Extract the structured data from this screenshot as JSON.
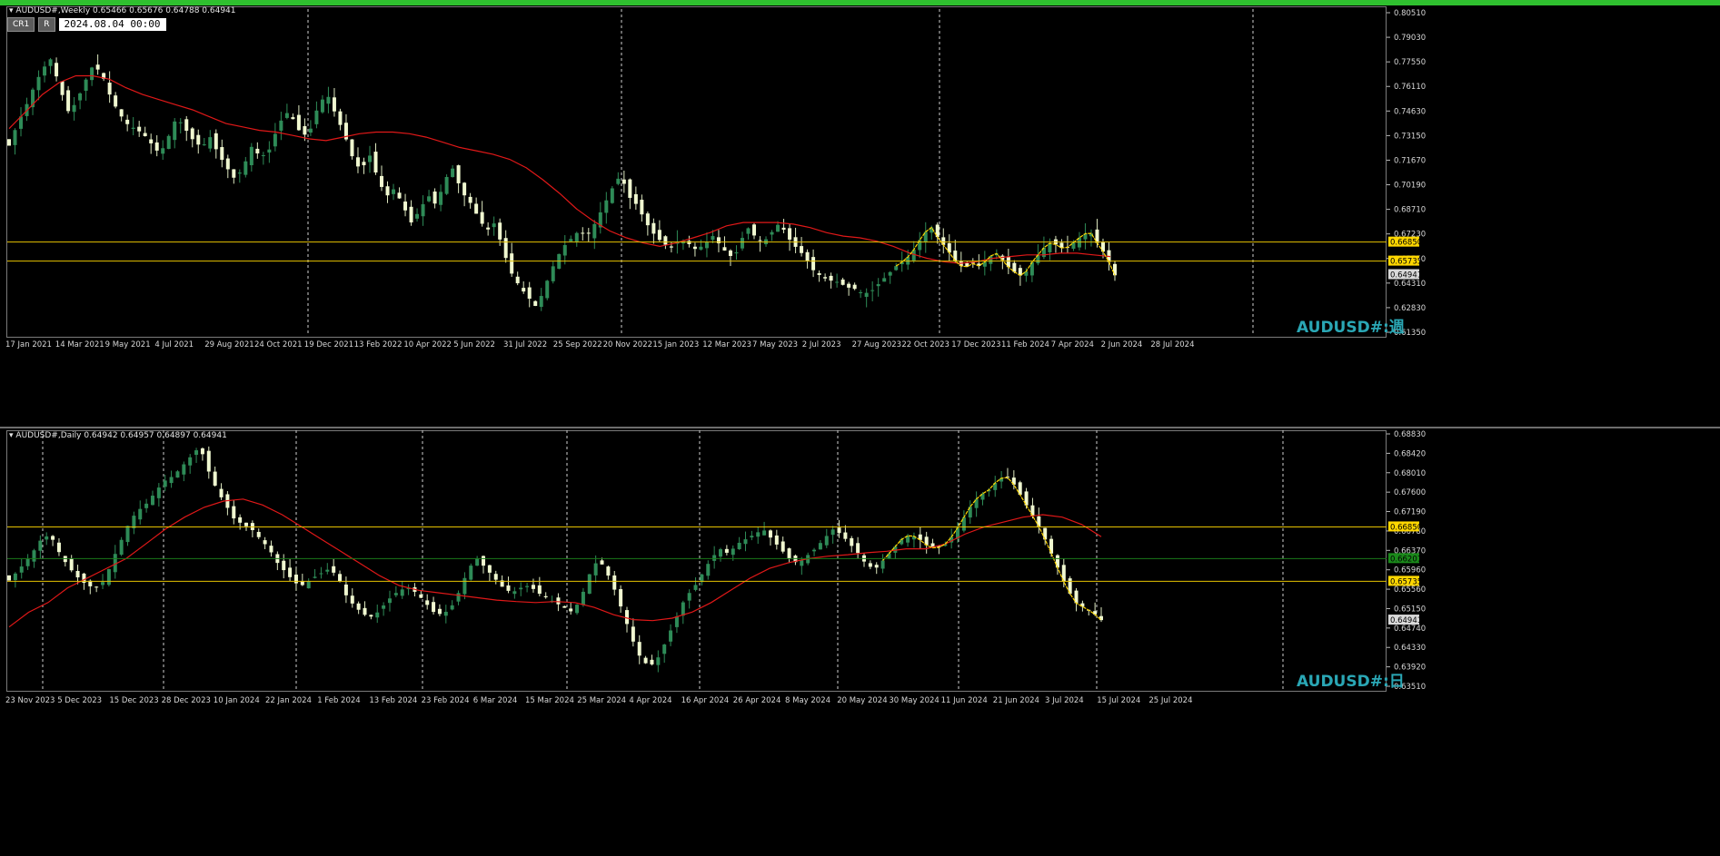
{
  "top_chart": {
    "header": "AUDUSD#,Weekly  0.65466 0.65676 0.64788 0.64941",
    "buttons": {
      "cr1": "CR1",
      "r": "R"
    },
    "datetime_value": "2024.08.04 00:00",
    "watermark": "AUDUSD#:週",
    "y_ticks": [
      "0.80510",
      "0.79030",
      "0.77550",
      "0.76110",
      "0.74630",
      "0.73150",
      "0.71670",
      "0.70190",
      "0.68710",
      "0.67230",
      "0.65750",
      "0.64310",
      "0.62830",
      "0.61350"
    ],
    "x_ticks": [
      "17 Jan 2021",
      "14 Mar 2021",
      "9 May 2021",
      "4 Jul 2021",
      "29 Aug 2021",
      "24 Oct 2021",
      "19 Dec 2021",
      "13 Feb 2022",
      "10 Apr 2022",
      "5 Jun 2022",
      "31 Jul 2022",
      "25 Sep 2022",
      "20 Nov 2022",
      "15 Jan 2023",
      "12 Mar 2023",
      "7 May 2023",
      "2 Jul 2023",
      "27 Aug 2023",
      "22 Oct 2023",
      "17 Dec 2023",
      "11 Feb 2024",
      "7 Apr 2024",
      "2 Jun 2024",
      "28 Jul 2024"
    ],
    "price_labels": [
      {
        "text": "0.66850",
        "value": 0.6685,
        "bg": "#ffd700",
        "fg": "#000000"
      },
      {
        "text": "0.65735",
        "value": 0.65735,
        "bg": "#ffd700",
        "fg": "#000000"
      },
      {
        "text": "0.64941",
        "value": 0.64941,
        "bg": "#d9d9d9",
        "fg": "#000000"
      }
    ]
  },
  "bottom_chart": {
    "header": "AUDUSD#,Daily  0.64942 0.64957 0.64897 0.64941",
    "watermark": "AUDUSD#:日",
    "y_ticks": [
      "0.68830",
      "0.68420",
      "0.68010",
      "0.67600",
      "0.67190",
      "0.66780",
      "0.66370",
      "0.65960",
      "0.65560",
      "0.65150",
      "0.64740",
      "0.64330",
      "0.63920",
      "0.63510"
    ],
    "x_ticks": [
      "23 Nov 2023",
      "5 Dec 2023",
      "15 Dec 2023",
      "28 Dec 2023",
      "10 Jan 2024",
      "22 Jan 2024",
      "1 Feb 2024",
      "13 Feb 2024",
      "23 Feb 2024",
      "6 Mar 2024",
      "15 Mar 2024",
      "25 Mar 2024",
      "4 Apr 2024",
      "16 Apr 2024",
      "26 Apr 2024",
      "8 May 2024",
      "20 May 2024",
      "30 May 2024",
      "11 Jun 2024",
      "21 Jun 2024",
      "3 Jul 2024",
      "15 Jul 2024",
      "25 Jul 2024"
    ],
    "price_labels": [
      {
        "text": "0.66850",
        "value": 0.6685,
        "bg": "#ffd700",
        "fg": "#000000"
      },
      {
        "text": "0.66201",
        "value": 0.66201,
        "bg": "#1a8a1a",
        "fg": "#000000"
      },
      {
        "text": "0.65735",
        "value": 0.65735,
        "bg": "#ffd700",
        "fg": "#000000"
      },
      {
        "text": "0.64941",
        "value": 0.64941,
        "bg": "#d9d9d9",
        "fg": "#000000"
      }
    ]
  },
  "chart_data": [
    {
      "type": "candlestick",
      "symbol": "AUDUSD#",
      "timeframe": "Weekly",
      "ylim": [
        0.6135,
        0.8051
      ],
      "last": {
        "open": 0.65466,
        "high": 0.65676,
        "low": 0.64788,
        "close": 0.64941
      },
      "horizontal_lines": [
        0.6685,
        0.65735
      ],
      "close_path": [
        0.725,
        0.738,
        0.748,
        0.76,
        0.77,
        0.776,
        0.76,
        0.745,
        0.75,
        0.762,
        0.772,
        0.768,
        0.755,
        0.745,
        0.738,
        0.735,
        0.732,
        0.726,
        0.72,
        0.73,
        0.742,
        0.735,
        0.728,
        0.724,
        0.73,
        0.72,
        0.712,
        0.705,
        0.713,
        0.725,
        0.718,
        0.722,
        0.735,
        0.745,
        0.74,
        0.73,
        0.735,
        0.75,
        0.755,
        0.743,
        0.732,
        0.718,
        0.71,
        0.72,
        0.706,
        0.695,
        0.7,
        0.69,
        0.68,
        0.687,
        0.696,
        0.69,
        0.705,
        0.712,
        0.698,
        0.692,
        0.683,
        0.675,
        0.68,
        0.663,
        0.65,
        0.642,
        0.636,
        0.63,
        0.643,
        0.655,
        0.665,
        0.67,
        0.675,
        0.672,
        0.68,
        0.69,
        0.7,
        0.708,
        0.695,
        0.69,
        0.68,
        0.673,
        0.668,
        0.665,
        0.67,
        0.668,
        0.664,
        0.667,
        0.672,
        0.666,
        0.66,
        0.663,
        0.678,
        0.672,
        0.668,
        0.674,
        0.68,
        0.671,
        0.665,
        0.66,
        0.652,
        0.648,
        0.646,
        0.645,
        0.642,
        0.641,
        0.638,
        0.64,
        0.645,
        0.65,
        0.655,
        0.658,
        0.664,
        0.672,
        0.678,
        0.67,
        0.664,
        0.657,
        0.653,
        0.656,
        0.654,
        0.66,
        0.662,
        0.655,
        0.651,
        0.648,
        0.656,
        0.662,
        0.668,
        0.667,
        0.664,
        0.668,
        0.672,
        0.675,
        0.667,
        0.66,
        0.649
      ],
      "ma_path": [
        0.735,
        0.745,
        0.755,
        0.762,
        0.766,
        0.766,
        0.764,
        0.759,
        0.755,
        0.752,
        0.749,
        0.746,
        0.742,
        0.738,
        0.736,
        0.734,
        0.733,
        0.731,
        0.729,
        0.728,
        0.73,
        0.732,
        0.733,
        0.733,
        0.732,
        0.73,
        0.727,
        0.724,
        0.722,
        0.72,
        0.717,
        0.712,
        0.705,
        0.697,
        0.688,
        0.681,
        0.675,
        0.671,
        0.668,
        0.666,
        0.668,
        0.671,
        0.674,
        0.678,
        0.68,
        0.68,
        0.68,
        0.679,
        0.677,
        0.674,
        0.672,
        0.671,
        0.669,
        0.666,
        0.662,
        0.659,
        0.657,
        0.656,
        0.657,
        0.659,
        0.66,
        0.661,
        0.661,
        0.662,
        0.662,
        0.661,
        0.66
      ]
    },
    {
      "type": "candlestick",
      "symbol": "AUDUSD#",
      "timeframe": "Daily",
      "ylim": [
        0.6351,
        0.6883
      ],
      "last": {
        "open": 0.64942,
        "high": 0.64957,
        "low": 0.64897,
        "close": 0.64941
      },
      "horizontal_lines": [
        0.6685,
        0.65735
      ],
      "green_line": 0.66201,
      "close_path": [
        0.6575,
        0.6595,
        0.6615,
        0.664,
        0.6668,
        0.666,
        0.6625,
        0.66,
        0.658,
        0.6565,
        0.656,
        0.6575,
        0.662,
        0.666,
        0.67,
        0.672,
        0.6735,
        0.676,
        0.678,
        0.679,
        0.681,
        0.683,
        0.685,
        0.68,
        0.676,
        0.673,
        0.67,
        0.669,
        0.668,
        0.666,
        0.664,
        0.661,
        0.659,
        0.657,
        0.6565,
        0.658,
        0.659,
        0.66,
        0.658,
        0.654,
        0.652,
        0.6505,
        0.65,
        0.652,
        0.654,
        0.6555,
        0.656,
        0.655,
        0.653,
        0.651,
        0.6505,
        0.652,
        0.6555,
        0.66,
        0.662,
        0.66,
        0.658,
        0.656,
        0.655,
        0.656,
        0.6565,
        0.655,
        0.654,
        0.653,
        0.652,
        0.651,
        0.654,
        0.659,
        0.662,
        0.659,
        0.655,
        0.65,
        0.645,
        0.641,
        0.64,
        0.642,
        0.646,
        0.65,
        0.654,
        0.656,
        0.659,
        0.662,
        0.664,
        0.663,
        0.665,
        0.666,
        0.667,
        0.668,
        0.666,
        0.664,
        0.662,
        0.661,
        0.6625,
        0.664,
        0.666,
        0.668,
        0.667,
        0.665,
        0.663,
        0.6605,
        0.66,
        0.662,
        0.664,
        0.666,
        0.667,
        0.666,
        0.6645,
        0.664,
        0.665,
        0.667,
        0.67,
        0.673,
        0.675,
        0.676,
        0.678,
        0.679,
        0.677,
        0.674,
        0.671,
        0.668,
        0.664,
        0.66,
        0.656,
        0.653,
        0.652,
        0.651,
        0.6494
      ],
      "ma_path": [
        0.648,
        0.651,
        0.653,
        0.656,
        0.658,
        0.66,
        0.662,
        0.665,
        0.668,
        0.6705,
        0.6725,
        0.6738,
        0.6742,
        0.673,
        0.671,
        0.6685,
        0.666,
        0.6635,
        0.661,
        0.6585,
        0.6565,
        0.6555,
        0.655,
        0.6545,
        0.654,
        0.6535,
        0.6532,
        0.653,
        0.6532,
        0.653,
        0.652,
        0.6505,
        0.6495,
        0.6493,
        0.6498,
        0.651,
        0.653,
        0.6555,
        0.658,
        0.66,
        0.6612,
        0.662,
        0.6625,
        0.6628,
        0.6632,
        0.6635,
        0.664,
        0.664,
        0.665,
        0.667,
        0.6685,
        0.6695,
        0.6705,
        0.671,
        0.6705,
        0.669,
        0.6665
      ]
    }
  ]
}
